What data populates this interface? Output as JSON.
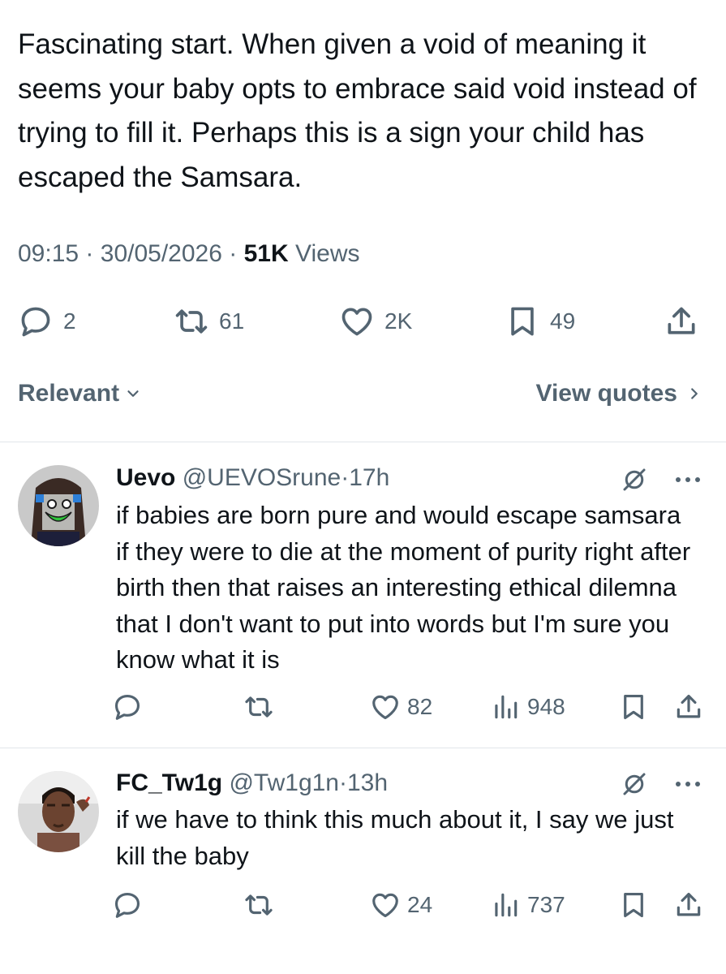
{
  "tweet": {
    "text": "Fascinating start. When given a void of meaning it seems your baby opts to embrace said void instead of trying to fill it. Perhaps this is a sign your child has escaped the Samsara.",
    "time": "09:15",
    "date": "30/05/2026",
    "views_count": "51K",
    "views_label": "Views",
    "separator": "·",
    "stats": {
      "replies": "2",
      "reposts": "61",
      "likes": "2K",
      "bookmarks": "49"
    }
  },
  "sort": {
    "relevant_label": "Relevant",
    "view_quotes_label": "View quotes"
  },
  "replies": [
    {
      "name": "Uevo",
      "handle": "@UEVOSrune",
      "separator": "·",
      "time": "17h",
      "text": "if babies are born pure and would escape samsara if they were to die at the moment of purity right after birth then that raises an interesting ethical dilemna that I don't want to put into words but I'm sure you know what it is",
      "likes": "82",
      "views": "948"
    },
    {
      "name": "FC_Tw1g",
      "handle": "@Tw1g1n",
      "separator": "·",
      "time": "13h",
      "text": "if we have to think this much about it, I say we just kill the baby",
      "likes": "24",
      "views": "737"
    }
  ],
  "icons": {
    "reply": "reply-icon",
    "repost": "repost-icon",
    "like": "heart-icon",
    "bookmark": "bookmark-icon",
    "share": "share-icon",
    "views": "views-chart-icon",
    "grok": "grok-icon",
    "more": "more-icon"
  },
  "colors": {
    "text": "#0f1419",
    "secondary": "#536471",
    "divider": "#e1e6ea"
  }
}
